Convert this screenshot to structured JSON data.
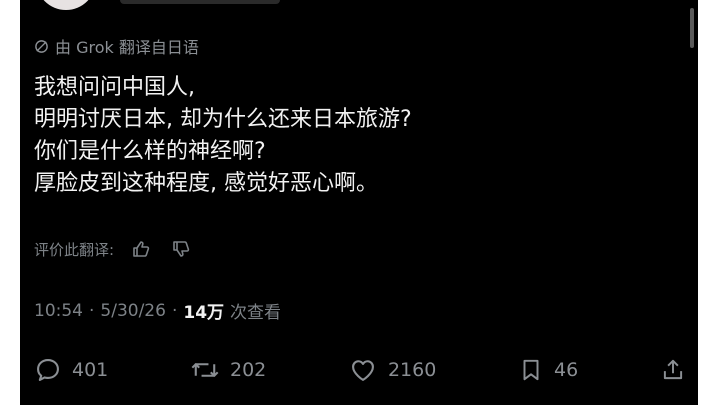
{
  "translation_note": {
    "label": "由 Grok 翻译自日语",
    "icon": "globe-icon"
  },
  "post": {
    "lines": [
      "我想问问中国人,",
      "明明讨厌日本, 却为什么还来日本旅游?",
      "你们是什么样的神经啊?",
      "厚脸皮到这种程度, 感觉好恶心啊。"
    ]
  },
  "rate_translation": {
    "label": "评价此翻译:",
    "thumbs_up_icon": "thumbs-up-icon",
    "thumbs_down_icon": "thumbs-down-icon"
  },
  "meta": {
    "time": "10:54",
    "separator": "·",
    "date": "5/30/26",
    "views_count": "14万",
    "views_label": "次查看"
  },
  "actions": {
    "replies": "401",
    "reposts": "202",
    "likes": "2160",
    "bookmarks": "46"
  },
  "colors": {
    "background": "#000000",
    "text_primary": "#f2f2f2",
    "text_secondary": "#7d8287"
  }
}
